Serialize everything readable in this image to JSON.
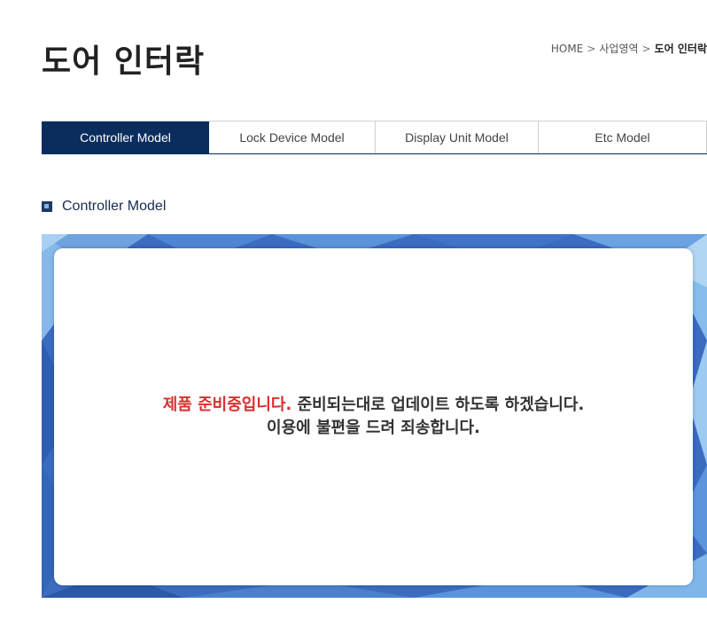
{
  "header": {
    "title": "도어 인터락",
    "breadcrumb": {
      "home": "HOME",
      "level1": "사업영역",
      "current": "도어 인터락"
    }
  },
  "tabs": [
    {
      "label": "Controller Model",
      "active": true
    },
    {
      "label": "Lock Device Model",
      "active": false
    },
    {
      "label": "Display Unit Model",
      "active": false
    },
    {
      "label": "Etc Model",
      "active": false
    }
  ],
  "section": {
    "heading": "Controller Model",
    "icon": "square-bullet-icon"
  },
  "notice": {
    "highlight": "제품 준비중입니다.",
    "line1_rest": " 준비되는대로 업데이트 하도록 하겠습니다.",
    "line2": "이용에 불편을 드려 죄송합니다."
  },
  "colors": {
    "tab_active_bg": "#0b2d5e",
    "highlight_red": "#d9302c",
    "banner_blue": "#3a6fc3"
  }
}
